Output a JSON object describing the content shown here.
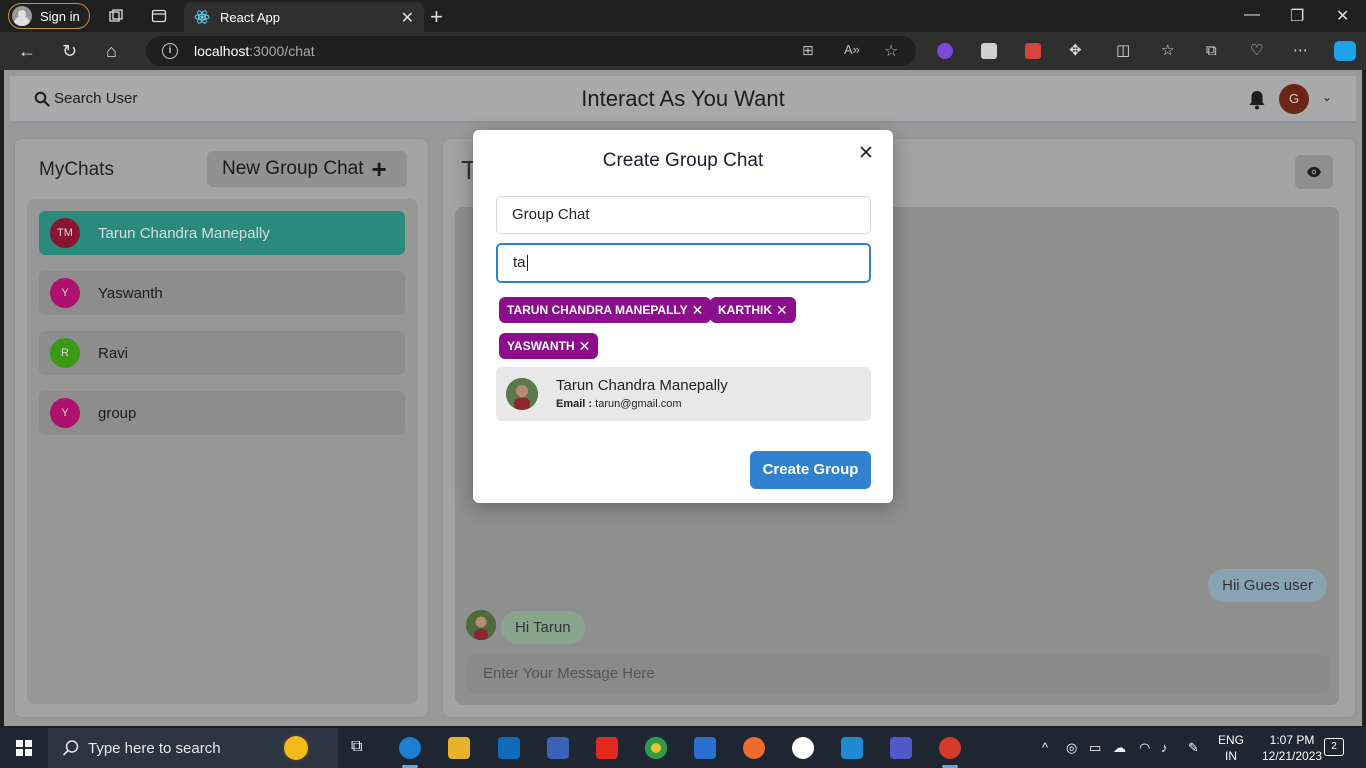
{
  "browser": {
    "signin_label": "Sign in",
    "tab_title": "React App",
    "url_host": "localhost",
    "url_path": ":3000/chat"
  },
  "header": {
    "search_label": "Search User",
    "app_title": "Interact As You Want",
    "user_initial": "G"
  },
  "mychats": {
    "title": "MyChats",
    "new_group_label": "New Group Chat",
    "items": [
      {
        "initials": "TM",
        "name": "Tarun Chandra Manepally",
        "avatar_color": "#8a1530",
        "active": true
      },
      {
        "initials": "Y",
        "name": "Yaswanth",
        "avatar_color": "#b0116f",
        "active": false
      },
      {
        "initials": "R",
        "name": "Ravi",
        "avatar_color": "#3a9a16",
        "active": false
      },
      {
        "initials": "Y",
        "name": "group",
        "avatar_color": "#b0116f",
        "active": false
      }
    ]
  },
  "chatbox": {
    "title_initial": "T",
    "messages": [
      {
        "text": "Hii Gues user",
        "side": "right"
      },
      {
        "text": "Hi Tarun",
        "side": "left"
      }
    ],
    "input_placeholder": "Enter Your Message Here"
  },
  "modal": {
    "title": "Create Group Chat",
    "group_name_value": "Group Chat",
    "search_value": "ta",
    "selected_users": [
      "TARUN CHANDRA MANEPALLY",
      "KARTHIK",
      "YASWANTH"
    ],
    "result": {
      "name": "Tarun Chandra Manepally",
      "email_label": "Email :",
      "email": "tarun@gmail.com"
    },
    "create_button": "Create Group"
  },
  "taskbar": {
    "search_placeholder": "Type here to search",
    "lang_top": "ENG",
    "lang_bottom": "IN",
    "time": "1:07 PM",
    "date": "12/21/2023",
    "notification_count": "2"
  },
  "colors": {
    "accent": "#3182ce",
    "badge": "#8b0f8d",
    "active_chat": "#2a8a7d"
  }
}
